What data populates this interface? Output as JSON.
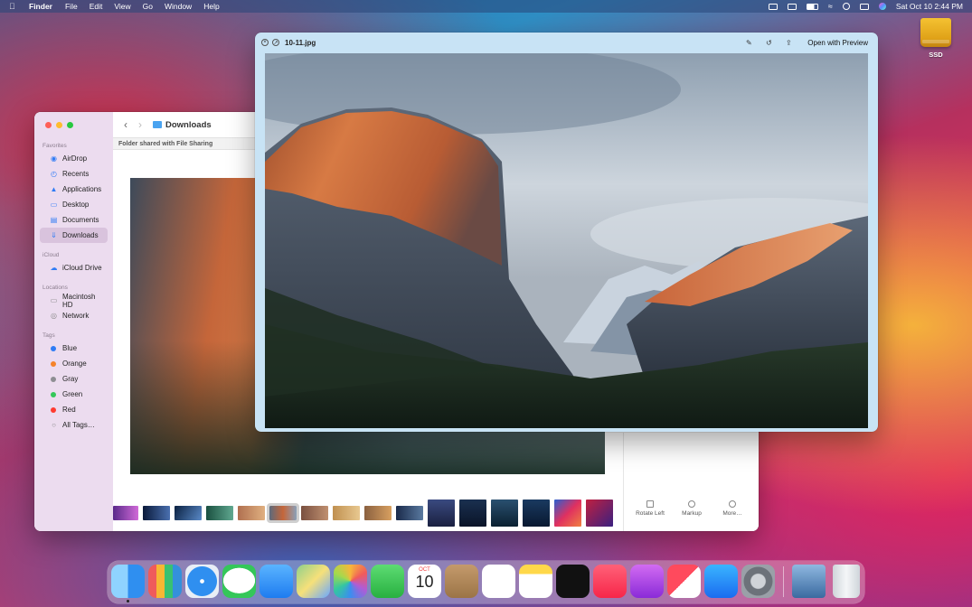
{
  "menubar": {
    "app": "Finder",
    "menus": [
      "File",
      "Edit",
      "View",
      "Go",
      "Window",
      "Help"
    ],
    "datetime": "Sat Oct 10  2:44 PM"
  },
  "desktop": {
    "drive_label": "SSD"
  },
  "finder": {
    "folder_title": "Downloads",
    "shared_notice": "Folder shared with File Sharing",
    "sections": {
      "favorites": "Favorites",
      "icloud": "iCloud",
      "locations": "Locations",
      "tags": "Tags"
    },
    "favorites": [
      "AirDrop",
      "Recents",
      "Applications",
      "Desktop",
      "Documents",
      "Downloads"
    ],
    "icloud": [
      "iCloud Drive"
    ],
    "locations": [
      "Macintosh HD",
      "Network"
    ],
    "tags": [
      {
        "label": "Blue",
        "color": "#2f7cf5"
      },
      {
        "label": "Orange",
        "color": "#f5832a"
      },
      {
        "label": "Gray",
        "color": "#8e8e93"
      },
      {
        "label": "Green",
        "color": "#34c759"
      },
      {
        "label": "Red",
        "color": "#ff3b30"
      }
    ],
    "all_tags": "All Tags…",
    "inspector_actions": [
      "Rotate Left",
      "Markup",
      "More…"
    ]
  },
  "quicklook": {
    "filename": "10-11.jpg",
    "open_button": "Open with Preview"
  },
  "dock": {
    "calendar_month": "OCT",
    "calendar_day": "10",
    "apps": [
      "finder",
      "launchpad",
      "safari",
      "messages",
      "mail",
      "maps",
      "photos",
      "facetime",
      "calendar",
      "contacts",
      "reminders",
      "notes",
      "tv",
      "music",
      "podcasts",
      "news",
      "app-store",
      "system-preferences",
      "downloads-stack",
      "trash"
    ]
  }
}
